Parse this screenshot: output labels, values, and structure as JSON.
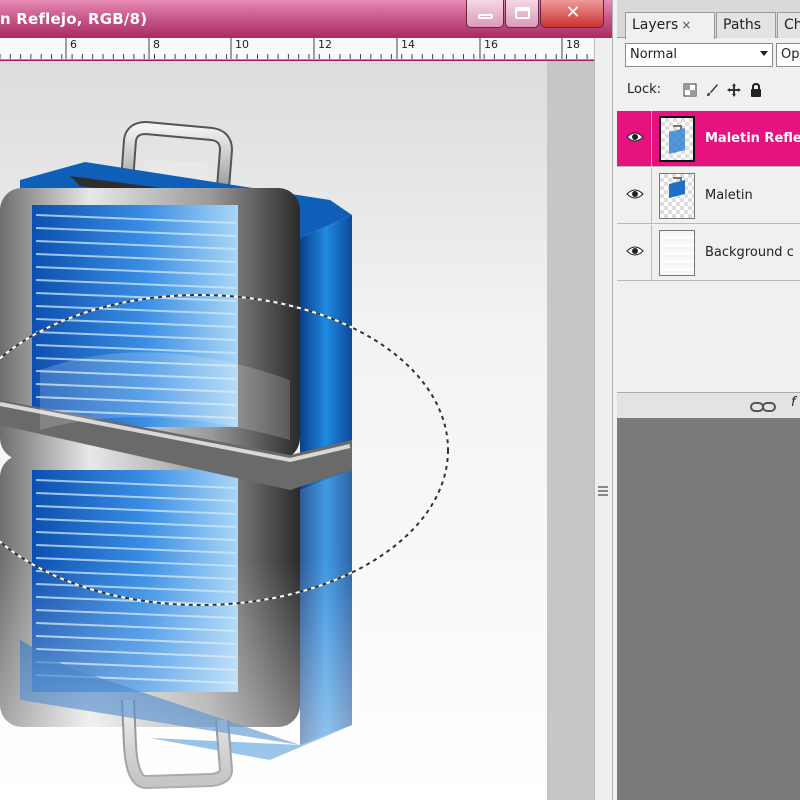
{
  "document": {
    "title": "n Reflejo, RGB/8)",
    "ruler_labels": [
      "6",
      "8",
      "10",
      "12",
      "14",
      "16",
      "18"
    ]
  },
  "panel": {
    "tabs": [
      "Layers",
      "Paths",
      "Cha"
    ],
    "tab_close_glyph": "×",
    "blend_mode": "Normal",
    "opacity_label": "Op",
    "lock_label": "Lock:",
    "layers": [
      {
        "name": "Maletin Refle",
        "selected": true,
        "visible": true
      },
      {
        "name": "Maletin",
        "selected": false,
        "visible": true
      },
      {
        "name": "Background c",
        "selected": false,
        "visible": true
      }
    ],
    "footer_fx": "f"
  },
  "colors": {
    "title_bar": "#c95a8c",
    "selected_layer": "#e6127f",
    "case_blue": "#1f7fd0"
  },
  "icons": [
    "minimize-icon",
    "maximize-icon",
    "close-icon",
    "eye-icon",
    "lock-transparent-icon",
    "brush-icon",
    "move-icon",
    "lock-icon",
    "link-icon"
  ]
}
